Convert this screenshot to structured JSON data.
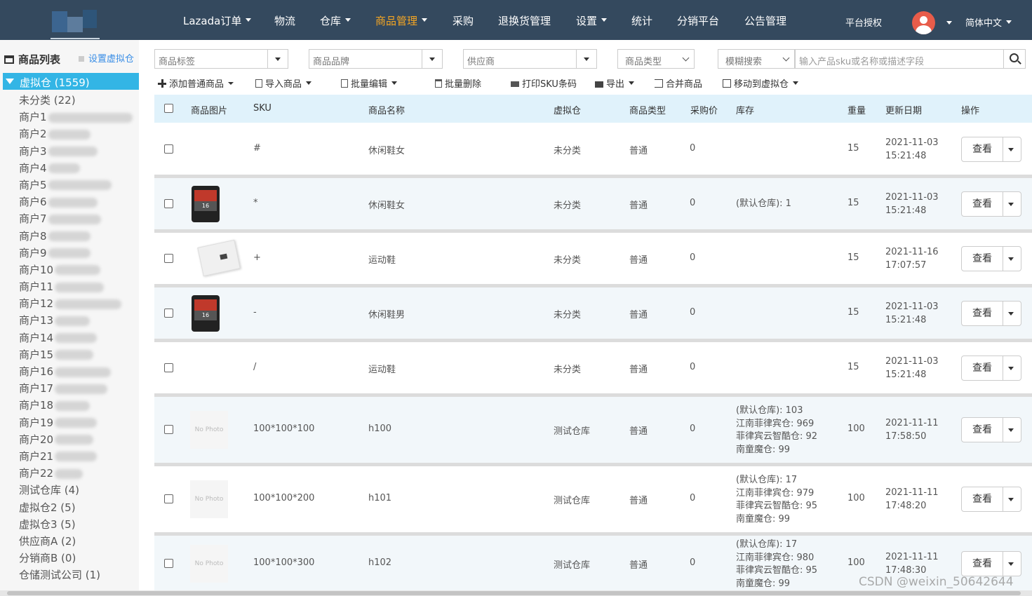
{
  "nav": {
    "items": [
      "Lazada订单",
      "物流",
      "仓库",
      "商品管理",
      "采购",
      "退换货管理",
      "设置",
      "统计",
      "分销平台",
      "公告管理"
    ],
    "auth": "平台授权",
    "lang": "简体中文",
    "active_color": "#f5a623",
    "bg_color": "#34495e"
  },
  "sidebar": {
    "title": "商品列表",
    "setting_link": "设置虚拟仓",
    "selected": "虚拟仓 (1559)",
    "items": [
      "未分类 (22)",
      "商户1",
      "商户2",
      "商户3",
      "商户4",
      "商户5",
      "商户6",
      "商户7",
      "商户8",
      "商户9",
      "商户10",
      "商户11",
      "商户12",
      "商户13",
      "商户14",
      "商户15",
      "商户16",
      "商户17",
      "商户18",
      "商户19",
      "商户20",
      "商户21",
      "商户22",
      "测试仓库 (4)",
      "虚拟仓2 (5)",
      "虚拟仓3 (5)",
      "供应商A (2)",
      "分销商B (0)",
      "仓储测试公司 (1)"
    ]
  },
  "filters": {
    "tag_placeholder": "商品标签",
    "brand_placeholder": "商品品牌",
    "supplier_placeholder": "供应商",
    "type_placeholder": "商品类型",
    "search_mode": "模糊搜索",
    "search_placeholder": "输入产品sku或名称或描述字段"
  },
  "toolbar": {
    "add": "添加普通商品",
    "import": "导入商品",
    "batch_edit": "批量编辑",
    "batch_delete": "批量删除",
    "print_sku": "打印SKU条码",
    "export": "导出",
    "merge": "合并商品",
    "move": "移动到虚拟仓"
  },
  "table": {
    "headers": [
      "商品图片",
      "SKU",
      "商品名称",
      "虚拟仓",
      "商品类型",
      "采购价",
      "库存",
      "重量",
      "更新日期",
      "操作"
    ],
    "view_label": "查看",
    "no_photo": "No Photo",
    "rows": [
      {
        "sku": "#",
        "name": "休闲鞋女",
        "wh": "未分类",
        "type": "普通",
        "price": "0",
        "stock": [],
        "weight": "15",
        "date": "2021-11-03",
        "time": "15:21:48",
        "img": "none"
      },
      {
        "sku": "*",
        "name": "休闲鞋女",
        "wh": "未分类",
        "type": "普通",
        "price": "0",
        "stock": [
          "(默认仓库): 1"
        ],
        "weight": "15",
        "date": "2021-11-03",
        "time": "15:21:48",
        "img": "sd-card-icon"
      },
      {
        "sku": "+",
        "name": "运动鞋",
        "wh": "未分类",
        "type": "普通",
        "price": "0",
        "stock": [],
        "weight": "15",
        "date": "2021-11-16",
        "time": "17:07:57",
        "img": "envelope-icon"
      },
      {
        "sku": "-",
        "name": "休闲鞋男",
        "wh": "未分类",
        "type": "普通",
        "price": "0",
        "stock": [],
        "weight": "15",
        "date": "2021-11-03",
        "time": "15:21:48",
        "img": "sd-card-icon"
      },
      {
        "sku": "/",
        "name": "运动鞋",
        "wh": "未分类",
        "type": "普通",
        "price": "0",
        "stock": [],
        "weight": "15",
        "date": "2021-11-03",
        "time": "15:21:48",
        "img": "none"
      },
      {
        "sku": "100*100*100",
        "name": "h100",
        "wh": "测试仓库",
        "type": "普通",
        "price": "0",
        "stock": [
          "(默认仓库): 103",
          "江南菲律宾仓: 969",
          "菲律宾云智酷仓: 92",
          "南童魔仓: 99"
        ],
        "weight": "100",
        "date": "2021-11-11",
        "time": "17:58:50",
        "img": "no-photo"
      },
      {
        "sku": "100*100*200",
        "name": "h101",
        "wh": "测试仓库",
        "type": "普通",
        "price": "0",
        "stock": [
          "(默认仓库): 17",
          "江南菲律宾仓: 979",
          "菲律宾云智酷仓: 95",
          "南童魔仓: 99"
        ],
        "weight": "100",
        "date": "2021-11-11",
        "time": "17:48:20",
        "img": "no-photo"
      },
      {
        "sku": "100*100*300",
        "name": "h102",
        "wh": "测试仓库",
        "type": "普通",
        "price": "0",
        "stock": [
          "(默认仓库): 17",
          "江南菲律宾仓: 980",
          "菲律宾云智酷仓: 95",
          "南童魔仓: 99"
        ],
        "weight": "100",
        "date": "2021-11-11",
        "time": "17:48:30",
        "img": "no-photo"
      }
    ]
  },
  "watermark": "CSDN @weixin_50642644"
}
